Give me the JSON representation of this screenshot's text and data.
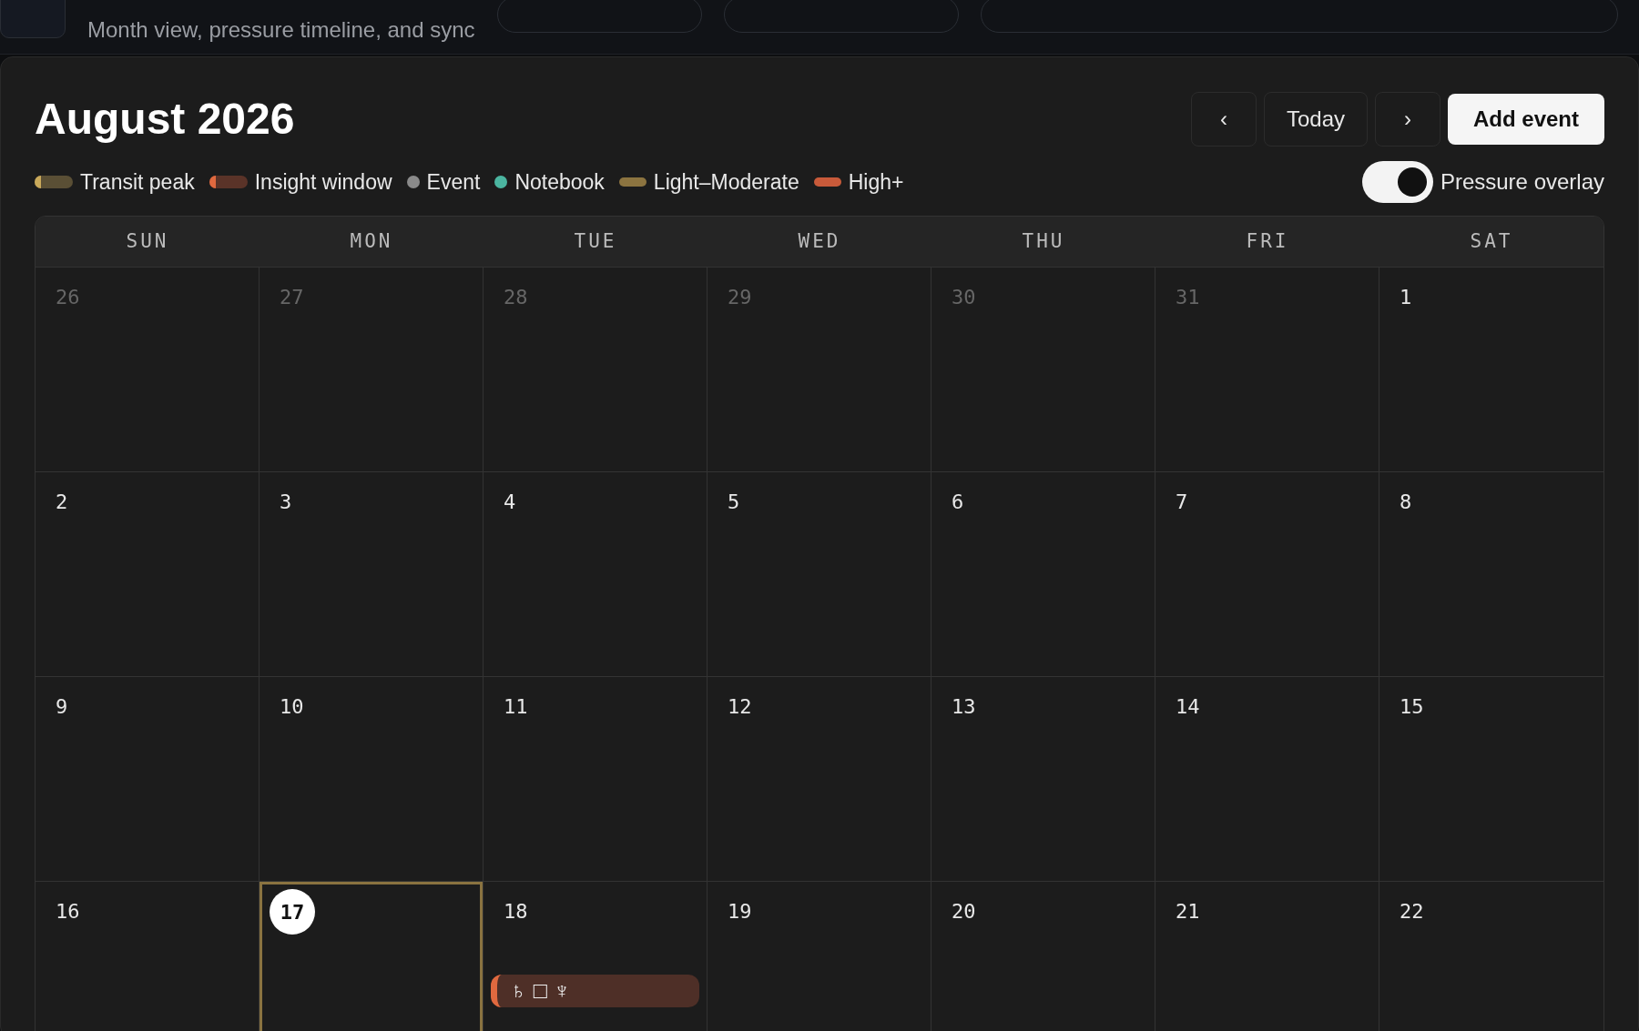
{
  "header": {
    "subtitle": "Month view, pressure timeline, and sync"
  },
  "calendar": {
    "title": "August 2026",
    "nav": {
      "prev": "‹",
      "today": "Today",
      "next": "›",
      "add": "Add event"
    },
    "legend": [
      {
        "kind": "pill",
        "label": "Transit peak",
        "color": "#5a4f35",
        "cap": {
          "color": "#c9a95a"
        }
      },
      {
        "kind": "pill",
        "label": "Insight window",
        "color": "#5a3328",
        "cap": {
          "color": "#e0693f"
        }
      },
      {
        "kind": "dot",
        "label": "Event",
        "color": "#8a8a8a"
      },
      {
        "kind": "dot",
        "label": "Notebook",
        "color": "#4bb5a0"
      },
      {
        "kind": "bar",
        "label": "Light–Moderate",
        "color": "#8c7440"
      },
      {
        "kind": "bar",
        "label": "High+",
        "color": "#c85a3a"
      }
    ],
    "overlay": {
      "label": "Pressure overlay",
      "on": true
    },
    "weekdays": [
      "SUN",
      "MON",
      "TUE",
      "WED",
      "THU",
      "FRI",
      "SAT"
    ],
    "weeks": [
      [
        {
          "day": "26",
          "muted": true
        },
        {
          "day": "27",
          "muted": true
        },
        {
          "day": "28",
          "muted": true
        },
        {
          "day": "29",
          "muted": true
        },
        {
          "day": "30",
          "muted": true
        },
        {
          "day": "31",
          "muted": true
        },
        {
          "day": "1",
          "muted": false
        }
      ],
      [
        {
          "day": "2",
          "muted": false
        },
        {
          "day": "3",
          "muted": false
        },
        {
          "day": "4",
          "muted": false
        },
        {
          "day": "5",
          "muted": false
        },
        {
          "day": "6",
          "muted": false
        },
        {
          "day": "7",
          "muted": false
        },
        {
          "day": "8",
          "muted": false
        }
      ],
      [
        {
          "day": "9",
          "muted": false
        },
        {
          "day": "10",
          "muted": false
        },
        {
          "day": "11",
          "muted": false
        },
        {
          "day": "12",
          "muted": false
        },
        {
          "day": "13",
          "muted": false
        },
        {
          "day": "14",
          "muted": false
        },
        {
          "day": "15",
          "muted": false
        }
      ],
      [
        {
          "day": "16",
          "muted": false
        },
        {
          "day": "17",
          "muted": false,
          "selected": true
        },
        {
          "day": "18",
          "muted": false,
          "events": [
            {
              "kind": "insight",
              "label": "♄ □ ♆"
            }
          ]
        },
        {
          "day": "19",
          "muted": false
        },
        {
          "day": "20",
          "muted": false
        },
        {
          "day": "21",
          "muted": false
        },
        {
          "day": "22",
          "muted": false
        }
      ]
    ]
  }
}
